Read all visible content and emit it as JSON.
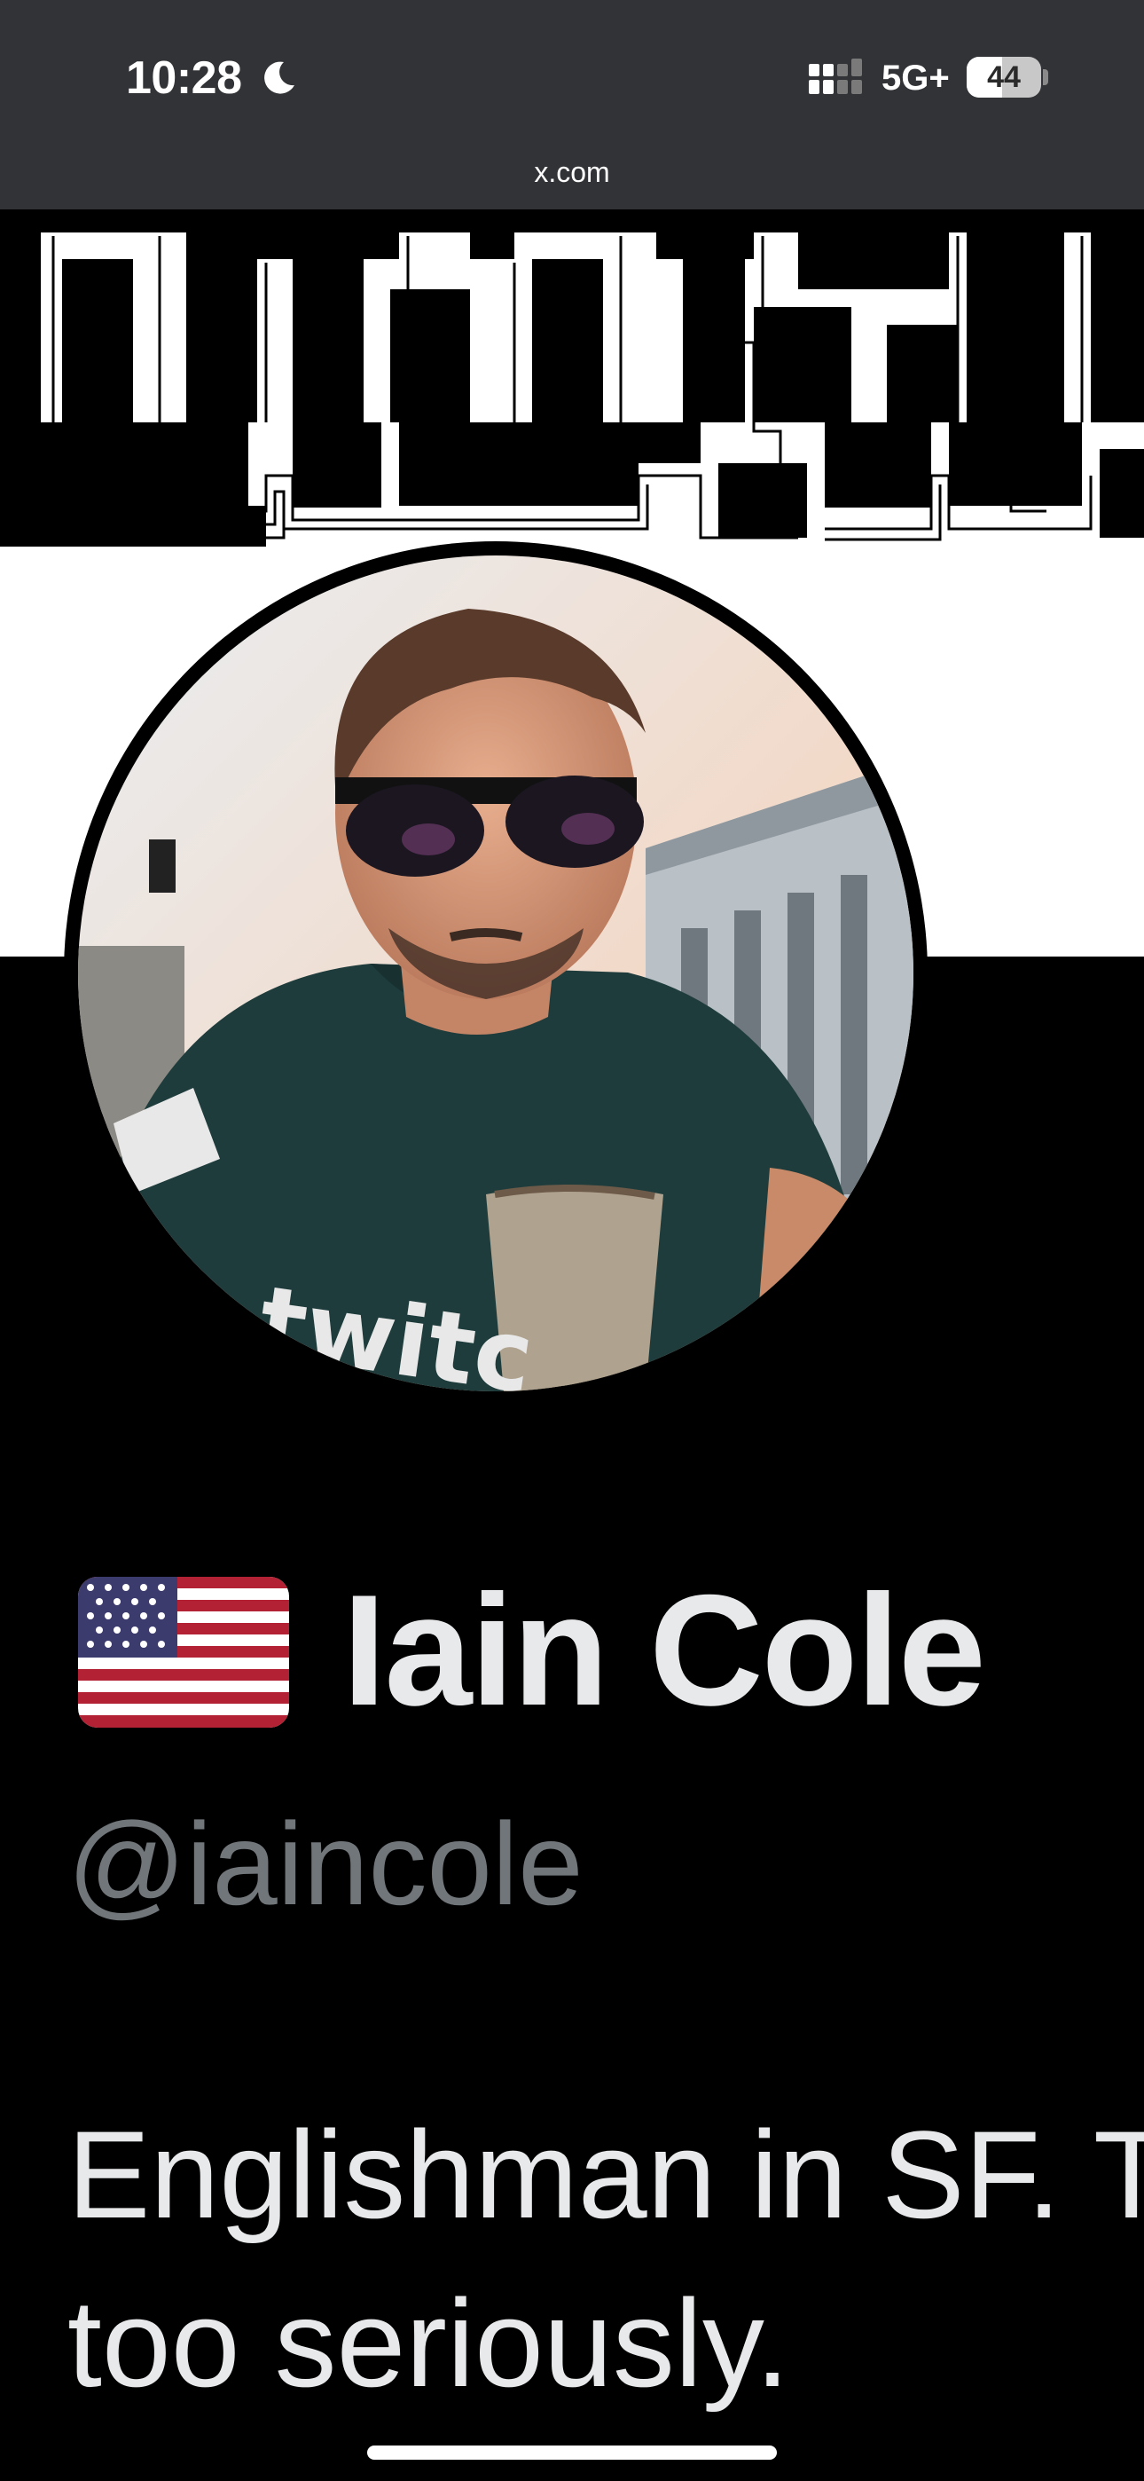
{
  "status_bar": {
    "time": "10:28",
    "network": "5G+",
    "battery": "44",
    "icons": [
      "moon-icon",
      "signal-icon",
      "battery-icon"
    ]
  },
  "browser": {
    "url": "x.com"
  },
  "profile": {
    "flag_icon": "us-flag-icon",
    "display_name": "Iain Cole",
    "handle": "@iaincole",
    "bio_line_1": "Englishman in SF. T",
    "bio_line_2": "too seriously."
  },
  "colors": {
    "background": "#000000",
    "status_bar": "#323336",
    "primary_text": "#e7e9ea",
    "secondary_text": "#71767b"
  }
}
